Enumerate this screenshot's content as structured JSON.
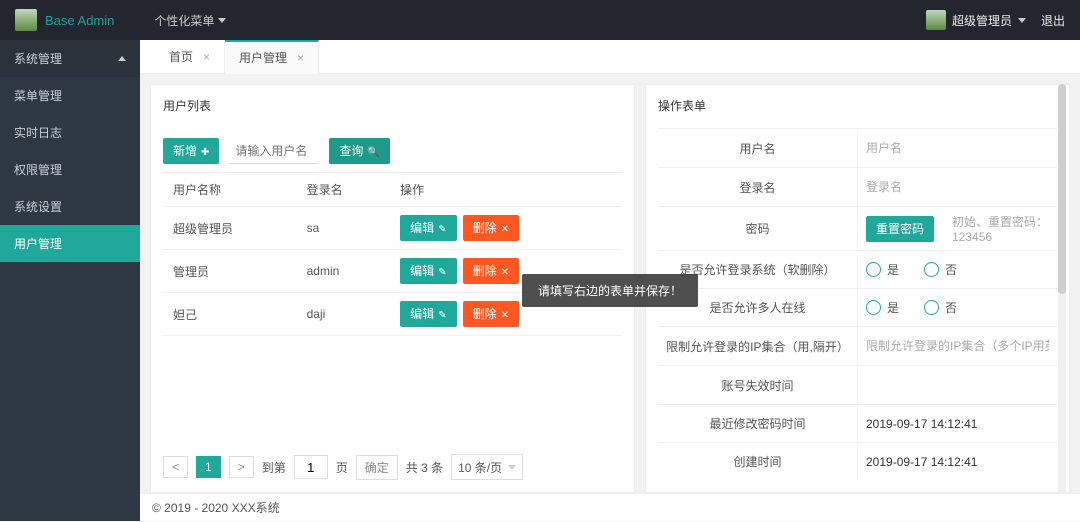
{
  "header": {
    "brand": "Base Admin",
    "nav_label": "个性化菜单",
    "user_name": "超级管理员",
    "logout": "退出"
  },
  "sidebar": {
    "header": "系统管理",
    "items": [
      {
        "label": "菜单管理"
      },
      {
        "label": "实时日志"
      },
      {
        "label": "权限管理"
      },
      {
        "label": "系统设置"
      },
      {
        "label": "用户管理"
      }
    ]
  },
  "tabs": [
    {
      "label": "首页"
    },
    {
      "label": "用户管理"
    }
  ],
  "left_panel": {
    "title": "用户列表",
    "add_label": "新增",
    "search_placeholder": "请输入用户名",
    "search_btn": "查询",
    "columns": [
      "用户名称",
      "登录名",
      "操作"
    ],
    "rows": [
      {
        "name": "超级管理员",
        "login": "sa"
      },
      {
        "name": "管理员",
        "login": "admin"
      },
      {
        "name": "妲己",
        "login": "daji"
      }
    ],
    "op_edit": "编辑",
    "op_delete": "删除"
  },
  "pager": {
    "prev": "<",
    "current": "1",
    "next": ">",
    "jump_label": "到第",
    "jump_value": "1",
    "jump_suffix": "页",
    "confirm": "确定",
    "total": "共 3 条",
    "perpage": "10 条/页"
  },
  "right_panel": {
    "title": "操作表单",
    "fields": {
      "username_label": "用户名",
      "username_placeholder": "用户名",
      "login_label": "登录名",
      "login_placeholder": "登录名",
      "password_label": "密码",
      "reset_pwd_btn": "重置密码",
      "password_hint": "初始、重置密码：123456",
      "allow_login_label": "是否允许登录系统（软删除）",
      "allow_multi_label": "是否允许多人在线",
      "yes": "是",
      "no": "否",
      "ip_label": "限制允许登录的IP集合（用,隔开）",
      "ip_placeholder": "限制允许登录的IP集合（多个IP用英文逗号隔开",
      "expire_label": "账号失效时间",
      "pwd_modified_label": "最近修改密码时间",
      "pwd_modified_value": "2019-09-17 14:12:41",
      "created_label": "创建时间",
      "created_value": "2019-09-17 14:12:41"
    }
  },
  "toast": "请填写右边的表单并保存！",
  "footer": "© 2019 - 2020 XXX系统"
}
